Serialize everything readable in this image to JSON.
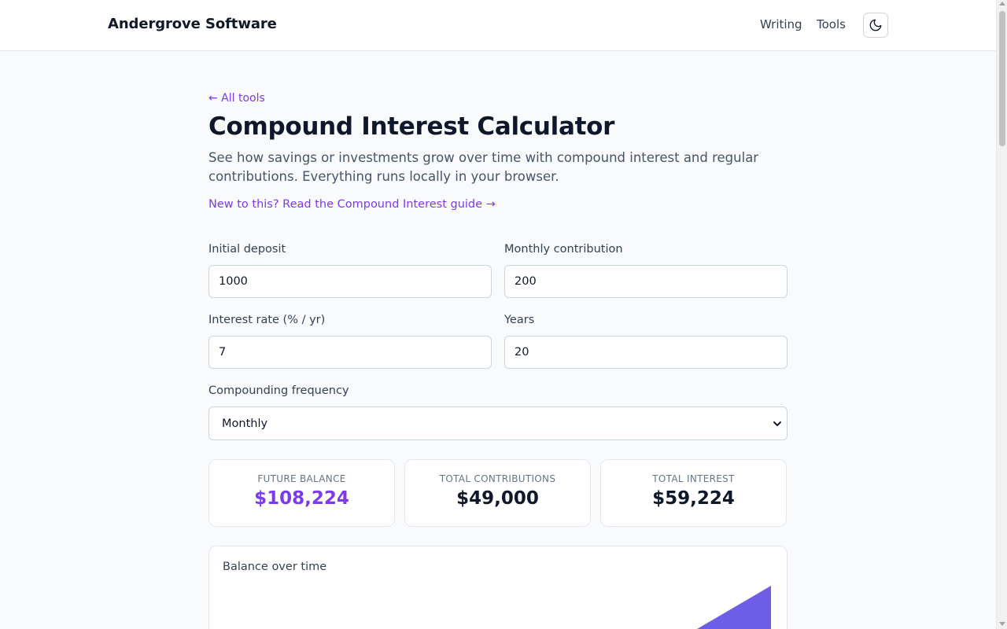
{
  "header": {
    "brand": "Andergrove Software",
    "nav": [
      "Writing",
      "Tools"
    ],
    "theme_icon": "moon-icon"
  },
  "back_link": "← All tools",
  "page_title": "Compound Interest Calculator",
  "intro": "See how savings or investments grow over time with compound interest and regular contributions. Everything runs locally in your browser.",
  "guide_link": "New to this? Read the Compound Interest guide →",
  "form": {
    "initial_deposit": {
      "label": "Initial deposit",
      "value": "1000"
    },
    "monthly_contribution": {
      "label": "Monthly contribution",
      "value": "200"
    },
    "interest_rate": {
      "label": "Interest rate (% / yr)",
      "value": "7"
    },
    "years": {
      "label": "Years",
      "value": "20"
    },
    "compounding": {
      "label": "Compounding frequency",
      "selected": "Monthly"
    }
  },
  "stats": [
    {
      "label": "FUTURE BALANCE",
      "value": "$108,224"
    },
    {
      "label": "TOTAL CONTRIBUTIONS",
      "value": "$49,000"
    },
    {
      "label": "TOTAL INTEREST",
      "value": "$59,224"
    }
  ],
  "colors": {
    "accent": "#7c3aed",
    "chart_fill": "#6d5de7"
  },
  "chart": {
    "title": "Balance over time"
  }
}
